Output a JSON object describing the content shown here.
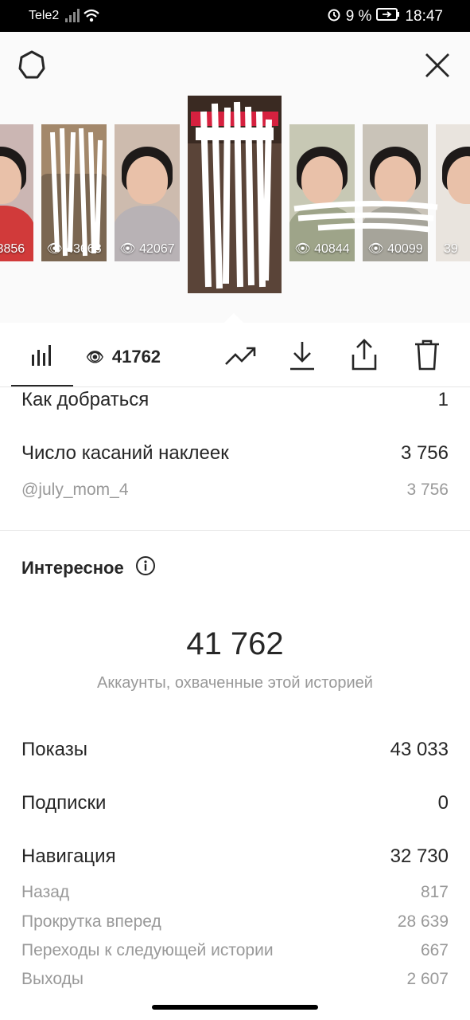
{
  "status_bar": {
    "carrier": "Tele2",
    "battery": "9 %",
    "time": "18:47"
  },
  "thumbnails": [
    {
      "views": "3856"
    },
    {
      "views": "43668"
    },
    {
      "views": "42067"
    },
    {
      "views": "41762",
      "active": true
    },
    {
      "views": "40844"
    },
    {
      "views": "40099"
    },
    {
      "views": "39"
    }
  ],
  "tabs": {
    "views_count": "41762"
  },
  "metrics_top": [
    {
      "label": "Как добраться",
      "value": "1"
    },
    {
      "label": "Число касаний наклеек",
      "value": "3 756"
    },
    {
      "label": "@july_mom_4",
      "value": "3 756",
      "sub": true
    }
  ],
  "section": {
    "title": "Интересное"
  },
  "reach": {
    "value": "41 762",
    "caption": "Аккаунты, охваченные этой историей"
  },
  "metrics_bottom": [
    {
      "label": "Показы",
      "value": "43 033"
    },
    {
      "label": "Подписки",
      "value": "0"
    },
    {
      "label": "Навигация",
      "value": "32 730"
    },
    {
      "label": "Назад",
      "value": "817",
      "sub": true
    },
    {
      "label": "Прокрутка вперед",
      "value": "28 639",
      "sub": true
    },
    {
      "label": "Переходы к следующей истории",
      "value": "667",
      "sub": true
    },
    {
      "label": "Выходы",
      "value": "2 607",
      "sub": true
    }
  ]
}
